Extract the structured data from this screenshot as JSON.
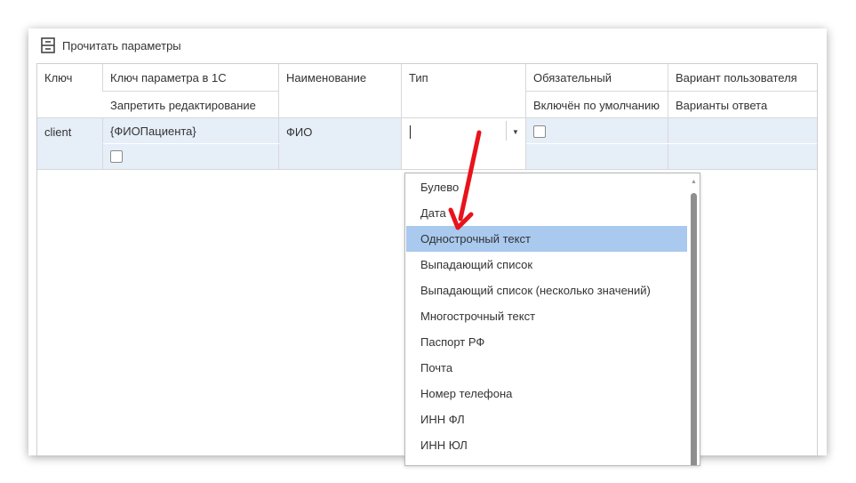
{
  "toolbar": {
    "read_params_label": "Прочитать параметры",
    "icon": "form-icon"
  },
  "headers": {
    "key": "Ключ",
    "param_key_1c": "Ключ параметра в 1С",
    "forbid_edit": "Запретить редактирование",
    "name": "Наименование",
    "type": "Тип",
    "required": "Обязательный",
    "enabled_default": "Включён по умолчанию",
    "user_variant": "Вариант пользователя",
    "answer_variants": "Варианты ответа"
  },
  "row": {
    "key": "client",
    "param_key_1c": "{ФИОПациента}",
    "name": "ФИО",
    "type_value": "",
    "forbid_edit_checked": false,
    "required_checked": false
  },
  "type_options": [
    "Булево",
    "Дата",
    "Однострочный текст",
    "Выпадающий список",
    "Выпадающий список (несколько значений)",
    "Многострочный текст",
    "Паспорт РФ",
    "Почта",
    "Номер телефона",
    "ИНН ФЛ",
    "ИНН ЮЛ"
  ],
  "selected_option_index": 2,
  "colors": {
    "row_bg": "#e6eef8",
    "selected_option": "#a9c9ee",
    "arrow": "#e8131b"
  }
}
